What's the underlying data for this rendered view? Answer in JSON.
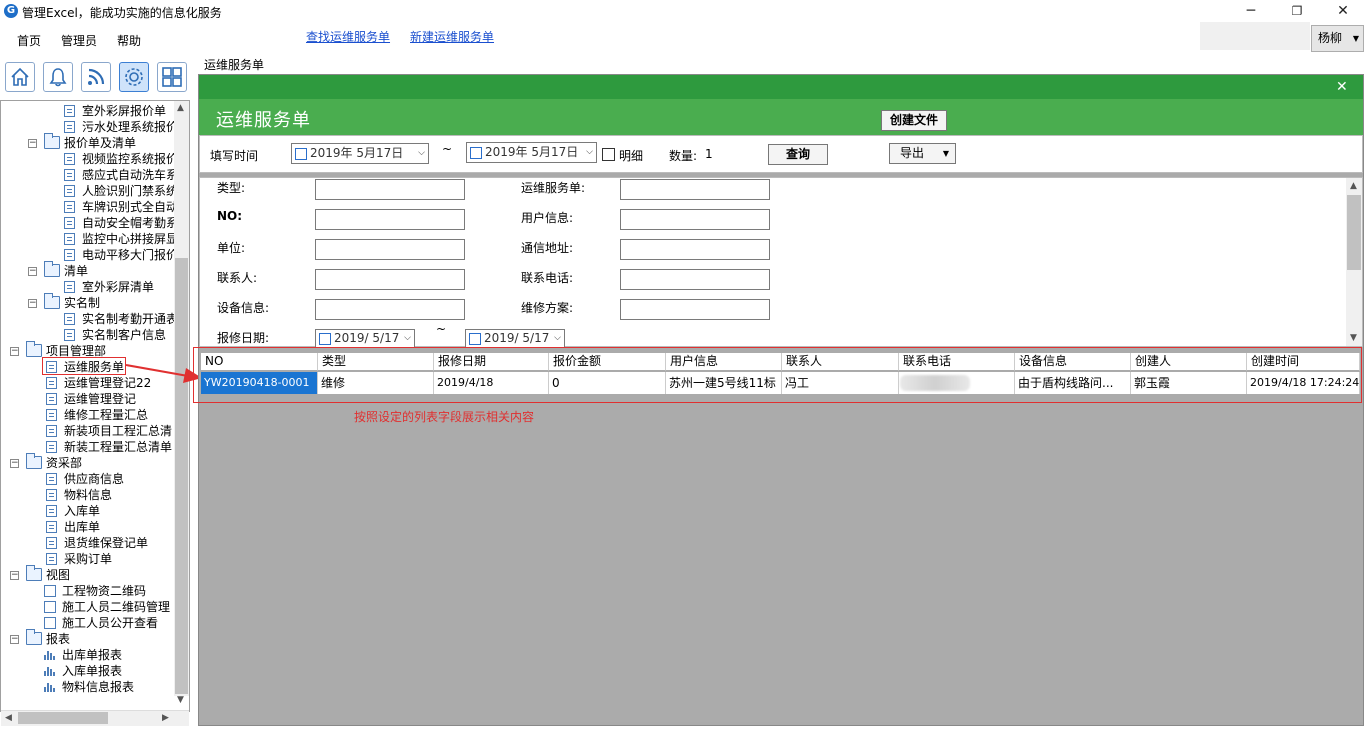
{
  "window": {
    "title": "管理Excel，能成功实施的信息化服务",
    "controls": {
      "minimize": "─",
      "restore": "❐",
      "close": "✕"
    }
  },
  "menu": [
    "首页",
    "管理员",
    "帮助"
  ],
  "top_links": [
    "查找运维服务单",
    "新建运维服务单"
  ],
  "user": {
    "name": "杨柳"
  },
  "toolbar": [
    "home-icon",
    "bell-icon",
    "rss-icon",
    "gear-icon",
    "grid-icon"
  ],
  "tree": {
    "items": [
      {
        "label": "室外彩屏报价单",
        "type": "doc",
        "level": 3
      },
      {
        "label": "污水处理系统报价",
        "type": "doc",
        "level": 3
      },
      {
        "label": "报价单及清单",
        "type": "folder",
        "level": 2,
        "toggle": "−"
      },
      {
        "label": "视频监控系统报价",
        "type": "doc",
        "level": 3
      },
      {
        "label": "感应式自动洗车系",
        "type": "doc",
        "level": 3
      },
      {
        "label": "人脸识别门禁系统",
        "type": "doc",
        "level": 3
      },
      {
        "label": "车牌识别式全自动",
        "type": "doc",
        "level": 3
      },
      {
        "label": "自动安全帽考勤系",
        "type": "doc",
        "level": 3
      },
      {
        "label": "监控中心拼接屏显",
        "type": "doc",
        "level": 3
      },
      {
        "label": "电动平移大门报价",
        "type": "doc",
        "level": 3
      },
      {
        "label": "清单",
        "type": "folder",
        "level": 2,
        "toggle": "−"
      },
      {
        "label": "室外彩屏清单",
        "type": "doc",
        "level": 3
      },
      {
        "label": "实名制",
        "type": "folder",
        "level": 2,
        "toggle": "−"
      },
      {
        "label": "实名制考勤开通表",
        "type": "doc",
        "level": 3
      },
      {
        "label": "实名制客户信息",
        "type": "doc",
        "level": 3
      },
      {
        "label": "项目管理部",
        "type": "folder",
        "level": 1,
        "toggle": "−"
      },
      {
        "label": "运维服务单",
        "type": "doc",
        "level": 2
      },
      {
        "label": "运维管理登记22",
        "type": "doc",
        "level": 2
      },
      {
        "label": "运维管理登记",
        "type": "doc",
        "level": 2
      },
      {
        "label": "维修工程量汇总",
        "type": "doc",
        "level": 2
      },
      {
        "label": "新装项目工程汇总清",
        "type": "doc",
        "level": 2
      },
      {
        "label": "新装工程量汇总清单",
        "type": "doc",
        "level": 2
      },
      {
        "label": "资采部",
        "type": "folder",
        "level": 1,
        "toggle": "−"
      },
      {
        "label": "供应商信息",
        "type": "doc",
        "level": 2
      },
      {
        "label": "物料信息",
        "type": "doc",
        "level": 2
      },
      {
        "label": "入库单",
        "type": "doc",
        "level": 2
      },
      {
        "label": "出库单",
        "type": "doc",
        "level": 2
      },
      {
        "label": "退货维保登记单",
        "type": "doc",
        "level": 2
      },
      {
        "label": "采购订单",
        "type": "doc",
        "level": 2
      },
      {
        "label": "视图",
        "type": "folder",
        "level": 1,
        "toggle": "−"
      },
      {
        "label": "工程物资二维码",
        "type": "qr",
        "level": 2
      },
      {
        "label": "施工人员二维码管理",
        "type": "qr",
        "level": 2
      },
      {
        "label": "施工人员公开查看",
        "type": "qr",
        "level": 2
      },
      {
        "label": "报表",
        "type": "folder",
        "level": 1,
        "toggle": "−"
      },
      {
        "label": "出库单报表",
        "type": "chart",
        "level": 2
      },
      {
        "label": "入库单报表",
        "type": "chart",
        "level": 2
      },
      {
        "label": "物料信息报表",
        "type": "chart",
        "level": 2
      }
    ]
  },
  "main": {
    "caption": "运维服务单",
    "close": "✕",
    "panel_title": "运维服务单",
    "create_button": "创建文件",
    "filter": {
      "label": "填写时间",
      "date_from": "2019年 5月17日",
      "tilde": "~",
      "date_to": "2019年 5月17日",
      "detail_label": "明细",
      "count_label": "数量:",
      "count_value": "1",
      "query_button": "查询",
      "export_button": "导出"
    },
    "form": {
      "left": [
        "类型:",
        "NO:",
        "单位:",
        "联系人:",
        "设备信息:"
      ],
      "right": [
        "运维服务单:",
        "用户信息:",
        "通信地址:",
        "联系电话:",
        "维修方案:"
      ],
      "repair_date_label": "报修日期:",
      "repair_date_from": "2019/ 5/17",
      "repair_date_tilde": "~",
      "repair_date_to": "2019/ 5/17"
    },
    "grid": {
      "columns": [
        "NO",
        "类型",
        "报修日期",
        "报价金额",
        "用户信息",
        "联系人",
        "联系电话",
        "设备信息",
        "创建人",
        "创建时间"
      ],
      "rows": [
        [
          "YW20190418-0001",
          "维修",
          "2019/4/18",
          "0",
          "苏州一建5号线11标",
          "冯工",
          "",
          "由于盾构线路问...",
          "郭玉霞",
          "2019/4/18 17:24:24"
        ]
      ]
    },
    "annotation": "按照设定的列表字段展示相关内容"
  },
  "colors": {
    "green_bar": "#2e9a3e",
    "green_panel": "#4aad4f",
    "selection": "#1a75d2",
    "annotation": "#e03030"
  }
}
